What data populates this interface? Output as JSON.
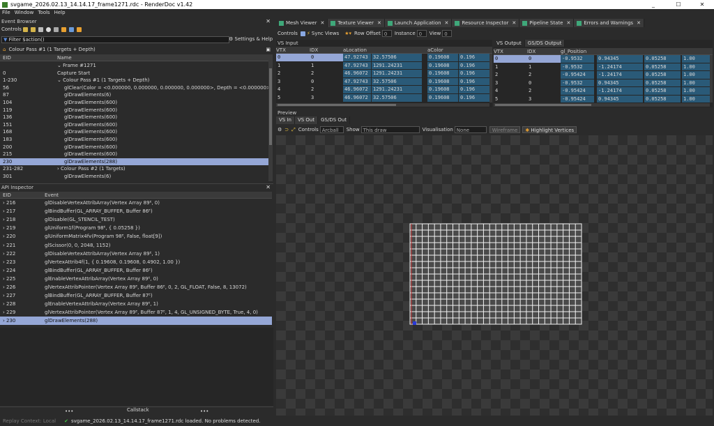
{
  "window": {
    "title": "svgame_2026.02.13_14.14.17_frame1271.rdc - RenderDoc v1.42",
    "min": "_",
    "max": "☐",
    "close": "✕"
  },
  "menu": [
    "File",
    "Window",
    "Tools",
    "Help"
  ],
  "event_browser": {
    "title": "Event Browser",
    "controls_label": "Controls",
    "filter_placeholder": "Filter $action()",
    "settings_label": "Settings & Help",
    "breadcrumb": "Colour Pass #1 (1 Targets + Depth)",
    "col_eid": "EID",
    "col_name": "Name",
    "rows": [
      {
        "eid": "",
        "name": "⌄ Frame #1271"
      },
      {
        "eid": "0",
        "name": "Capture Start"
      },
      {
        "eid": "1-230",
        "name": "⌄ Colour Pass #1 (1 Targets + Depth)"
      },
      {
        "eid": "56",
        "name": "glClear(Color = <0.000000, 0.000000, 0.000000, 0.000000>, Depth = <0.000000>, Stencil = <0x00>)"
      },
      {
        "eid": "87",
        "name": "glDrawElements(6)"
      },
      {
        "eid": "104",
        "name": "glDrawElements(600)"
      },
      {
        "eid": "119",
        "name": "glDrawElements(600)"
      },
      {
        "eid": "136",
        "name": "glDrawElements(600)"
      },
      {
        "eid": "151",
        "name": "glDrawElements(600)"
      },
      {
        "eid": "168",
        "name": "glDrawElements(600)"
      },
      {
        "eid": "183",
        "name": "glDrawElements(600)"
      },
      {
        "eid": "200",
        "name": "glDrawElements(600)"
      },
      {
        "eid": "215",
        "name": "glDrawElements(600)"
      },
      {
        "eid": "230",
        "name": "glDrawElements(288)",
        "selected": true
      },
      {
        "eid": "231-282",
        "name": "› Colour Pass #2 (1 Targets)"
      },
      {
        "eid": "301",
        "name": "glDrawElements(6)"
      },
      {
        "eid": "302-356",
        "name": "› Colour Pass #3 (1 Targets)"
      }
    ]
  },
  "api_inspector": {
    "title": "API Inspector",
    "col_eid": "EID",
    "col_event": "Event",
    "rows": [
      {
        "eid": "› 216",
        "event": "glDisableVertexAttribArray(Vertex Array 89ᴱ, 0)"
      },
      {
        "eid": "› 217",
        "event": "glBindBuffer(GL_ARRAY_BUFFER, Buffer 86ᴱ)"
      },
      {
        "eid": "› 218",
        "event": "glDisable(GL_STENCIL_TEST)"
      },
      {
        "eid": "› 219",
        "event": "glUniform1f(Program 98ᴱ, { 0.05258 })"
      },
      {
        "eid": "› 220",
        "event": "glUniformMatrix4fv(Program 98ᴱ, False, float[9])"
      },
      {
        "eid": "› 221",
        "event": "glScissor(0, 0, 2048, 1152)"
      },
      {
        "eid": "› 222",
        "event": "glDisableVertexAttribArray(Vertex Array 89ᴱ, 1)"
      },
      {
        "eid": "› 223",
        "event": "glVertexAttrib4f(1, { 0.19608, 0.19608, 0.4902, 1.00 })"
      },
      {
        "eid": "› 224",
        "event": "glBindBuffer(GL_ARRAY_BUFFER, Buffer 86ᴱ)"
      },
      {
        "eid": "› 225",
        "event": "glEnableVertexAttribArray(Vertex Array 89ᴱ, 0)"
      },
      {
        "eid": "› 226",
        "event": "glVertexAttribPointer(Vertex Array 89ᴱ, Buffer 86ᴱ, 0, 2, GL_FLOAT, False, 8, 13072)"
      },
      {
        "eid": "› 227",
        "event": "glBindBuffer(GL_ARRAY_BUFFER, Buffer 87ᴱ)"
      },
      {
        "eid": "› 228",
        "event": "glEnableVertexAttribArray(Vertex Array 89ᴱ, 1)"
      },
      {
        "eid": "› 229",
        "event": "glVertexAttribPointer(Vertex Array 89ᴱ, Buffer 87ᴱ, 1, 4, GL_UNSIGNED_BYTE, True, 4, 0)"
      },
      {
        "eid": "› 230",
        "event": "glDrawElements(288)",
        "selected": true
      }
    ],
    "callstack_label": "Callstack",
    "dots": "•••"
  },
  "tabs": [
    {
      "label": "Mesh Viewer",
      "active": true
    },
    {
      "label": "Texture Viewer"
    },
    {
      "label": "Launch Application"
    },
    {
      "label": "Resource Inspector"
    },
    {
      "label": "Pipeline State"
    },
    {
      "label": "Errors and Warnings"
    }
  ],
  "mesh_toolbar": {
    "controls": "Controls",
    "sync_views": "Sync Views",
    "row_offset_label": "Row Offset",
    "row_offset_value": "0",
    "instance_label": "Instance",
    "instance_value": "0",
    "view_label": "View",
    "view_value": "0"
  },
  "vs_input": {
    "title": "VS Input",
    "headers": [
      "VTX",
      "IDX",
      "aLocation",
      "",
      "aColor",
      ""
    ],
    "rows": [
      [
        "0",
        "0",
        "47.92743",
        "32.57506",
        "0.19608",
        "0.196"
      ],
      [
        "1",
        "1",
        "47.92743",
        "1291.24231",
        "0.19608",
        "0.196"
      ],
      [
        "2",
        "2",
        "46.96072",
        "1291.24231",
        "0.19608",
        "0.196"
      ],
      [
        "3",
        "0",
        "47.92743",
        "32.57506",
        "0.19608",
        "0.196"
      ],
      [
        "4",
        "2",
        "46.96072",
        "1291.24231",
        "0.19608",
        "0.196"
      ],
      [
        "5",
        "3",
        "46.96072",
        "32.57506",
        "0.19608",
        "0.196"
      ]
    ]
  },
  "vs_output": {
    "tab1": "VS Output",
    "tab2": "GS/DS Output",
    "headers": [
      "VTX",
      "IDX",
      "gl_Position",
      "",
      "",
      ""
    ],
    "rows": [
      [
        "0",
        "0",
        "-0.9532",
        "0.94345",
        "0.05258",
        "1.00"
      ],
      [
        "1",
        "1",
        "-0.9532",
        "-1.24174",
        "0.05258",
        "1.00"
      ],
      [
        "2",
        "2",
        "-0.95424",
        "-1.24174",
        "0.05258",
        "1.00"
      ],
      [
        "3",
        "0",
        "-0.9532",
        "0.94345",
        "0.05258",
        "1.00"
      ],
      [
        "4",
        "2",
        "-0.95424",
        "-1.24174",
        "0.05258",
        "1.00"
      ],
      [
        "5",
        "3",
        "-0.95424",
        "0.94345",
        "0.05258",
        "1.00"
      ]
    ]
  },
  "preview": {
    "title": "Preview",
    "tabs": [
      "VS In",
      "VS Out",
      "GS/DS Out"
    ],
    "controls_label": "Controls",
    "controls_value": "Arcball",
    "show_label": "Show",
    "show_value": "This draw",
    "visualisation_label": "Visualisation",
    "visualisation_value": "None",
    "wireframe_label": "Wireframe",
    "highlight_label": "Highlight Vertices"
  },
  "status": {
    "replay": "Replay Context: Local",
    "message": "svgame_2026.02.13_14.14.17_frame1271.rdc loaded. No problems detected."
  }
}
